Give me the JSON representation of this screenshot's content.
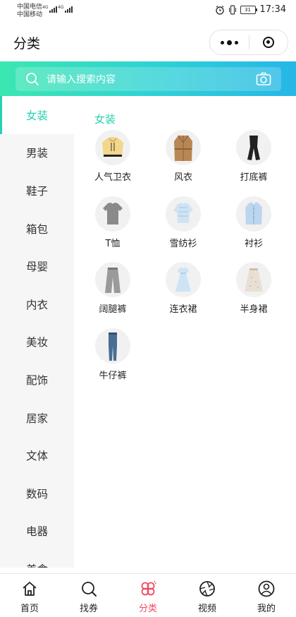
{
  "status": {
    "carrier1": "中国电信",
    "carrier2": "中国移动",
    "net1": "4G",
    "net2": "4G",
    "battery": "31",
    "time": "17:34"
  },
  "navbar": {
    "title": "分类"
  },
  "search": {
    "placeholder": "请输入搜索内容"
  },
  "sidebar": {
    "items": [
      "女装",
      "男装",
      "鞋子",
      "箱包",
      "母婴",
      "内衣",
      "美妆",
      "配饰",
      "居家",
      "文体",
      "数码",
      "电器",
      "美食"
    ],
    "active_index": 0
  },
  "content": {
    "title": "女装",
    "items": [
      {
        "label": "人气卫衣",
        "icon": "hoodie-icon"
      },
      {
        "label": "风衣",
        "icon": "trench-coat-icon"
      },
      {
        "label": "打底裤",
        "icon": "leggings-icon"
      },
      {
        "label": "T恤",
        "icon": "tshirt-icon"
      },
      {
        "label": "雪纺衫",
        "icon": "chiffon-blouse-icon"
      },
      {
        "label": "衬衫",
        "icon": "shirt-icon"
      },
      {
        "label": "阔腿裤",
        "icon": "wide-leg-pants-icon"
      },
      {
        "label": "连衣裙",
        "icon": "dress-icon"
      },
      {
        "label": "半身裙",
        "icon": "skirt-icon"
      },
      {
        "label": "牛仔裤",
        "icon": "jeans-icon"
      }
    ]
  },
  "tabbar": {
    "items": [
      {
        "label": "首页",
        "icon": "home-icon"
      },
      {
        "label": "找券",
        "icon": "search-icon"
      },
      {
        "label": "分类",
        "icon": "category-icon"
      },
      {
        "label": "视频",
        "icon": "video-icon"
      },
      {
        "label": "我的",
        "icon": "profile-icon"
      }
    ],
    "active_index": 2
  },
  "colors": {
    "accent": "#2ad0b0",
    "tab_active": "#ef4a62",
    "gradient_start": "#3be7b0",
    "gradient_end": "#26b6e8"
  }
}
